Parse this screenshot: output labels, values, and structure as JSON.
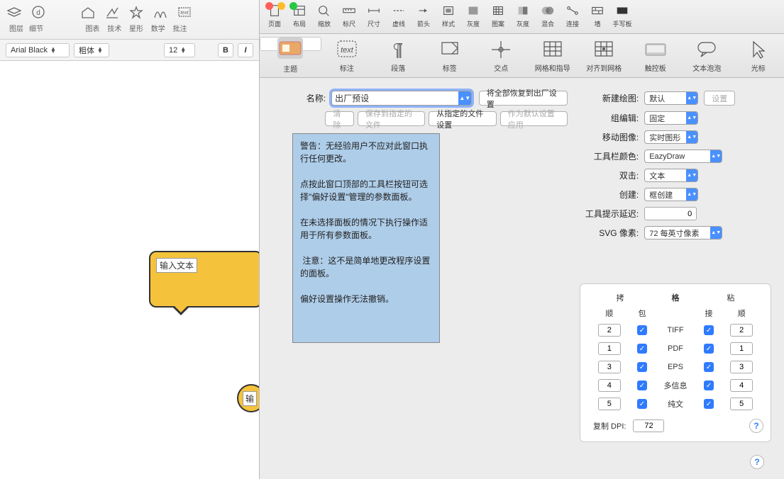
{
  "bg": {
    "groups": [
      {
        "icons": [
          "layers",
          "circle-d"
        ],
        "labels": [
          "图层",
          "细节"
        ]
      },
      {
        "icons": [
          "house",
          "insert",
          "star",
          "math",
          "text-note"
        ],
        "labels": [
          "图表",
          "技术",
          "星形",
          "数学",
          "批注"
        ]
      }
    ],
    "font": "Arial Black",
    "weight": "粗体",
    "size": "12",
    "bold": "B",
    "italic": "I"
  },
  "canvas": {
    "bubble1": "输入文本",
    "bubble2": "输"
  },
  "panel": {
    "tb1": [
      {
        "icon": "page",
        "label": "页面"
      },
      {
        "icon": "layout",
        "label": "布局"
      },
      {
        "icon": "zoom",
        "label": "缩放"
      },
      {
        "icon": "ruler",
        "label": "标尺"
      },
      {
        "icon": "dim",
        "label": "尺寸"
      },
      {
        "icon": "dash",
        "label": "虚线"
      },
      {
        "icon": "arrow",
        "label": "箭头"
      },
      {
        "icon": "style",
        "label": "样式"
      },
      {
        "icon": "gray",
        "label": "灰度"
      },
      {
        "icon": "pattern",
        "label": "图案"
      },
      {
        "icon": "gray2",
        "label": "灰度"
      },
      {
        "icon": "blend",
        "label": "混合"
      },
      {
        "icon": "connect",
        "label": "连接"
      },
      {
        "icon": "wall",
        "label": "墙"
      },
      {
        "icon": "handwrite",
        "label": "手写板"
      }
    ],
    "tb2": [
      {
        "icon": "theme",
        "label": "主题"
      },
      {
        "icon": "annot",
        "label": "标注"
      },
      {
        "icon": "para",
        "label": "段落"
      },
      {
        "icon": "tag",
        "label": "标签"
      },
      {
        "icon": "cross",
        "label": "交点"
      },
      {
        "icon": "grid",
        "label": "网格和指导"
      },
      {
        "icon": "snap",
        "label": "对齐到网格"
      },
      {
        "icon": "trackpad",
        "label": "触控板"
      },
      {
        "icon": "bubble",
        "label": "文本泡泡"
      },
      {
        "icon": "cursor",
        "label": "光标"
      }
    ],
    "left": {
      "name_label": "名称:",
      "name_value": "出厂预设",
      "reset_all": "将全部恢复到出厂设置",
      "clear": "清除",
      "save_to": "保存到指定的文件",
      "from_file": "从指定的文件设置",
      "as_default": "作为默认设置应用",
      "warning": "警告：无经验用户不应对此窗口执行任何更改。\n\n点按此窗口顶部的工具栏按钮可选择\"偏好设置\"管理的参数面板。\n\n在未选择面板的情况下执行操作适用于所有参数面板。\n\n 注意：这不是简单地更改程序设置的面板。\n\n偏好设置操作无法撤销。"
    },
    "right": {
      "items": [
        {
          "label": "新建绘图:",
          "value": "默认",
          "extra": "设置"
        },
        {
          "label": "组编辑:",
          "value": "固定"
        },
        {
          "label": "移动图像:",
          "value": "实时图形"
        },
        {
          "label": "工具栏颜色:",
          "value": "EazyDraw"
        },
        {
          "label": "双击:",
          "value": "文本"
        },
        {
          "label": "创建:",
          "value": "框创建"
        },
        {
          "label": "工具提示延迟:",
          "value": "0"
        },
        {
          "label": "SVG 像素:",
          "value": "72 每英寸像素"
        }
      ]
    },
    "grid": {
      "title": "格",
      "colg1": "拷",
      "colg2": "粘",
      "cols": [
        "顺",
        "包",
        "",
        "接",
        "顺"
      ],
      "rows": [
        {
          "a": "2",
          "fmt": "TIFF",
          "b": "2"
        },
        {
          "a": "1",
          "fmt": "PDF",
          "b": "1"
        },
        {
          "a": "3",
          "fmt": "EPS",
          "b": "3"
        },
        {
          "a": "4",
          "fmt": "多信息",
          "b": "4"
        },
        {
          "a": "5",
          "fmt": "纯文",
          "b": "5"
        }
      ],
      "dpi_label": "复制 DPI:",
      "dpi_value": "72",
      "help": "?"
    },
    "help2": "?"
  }
}
